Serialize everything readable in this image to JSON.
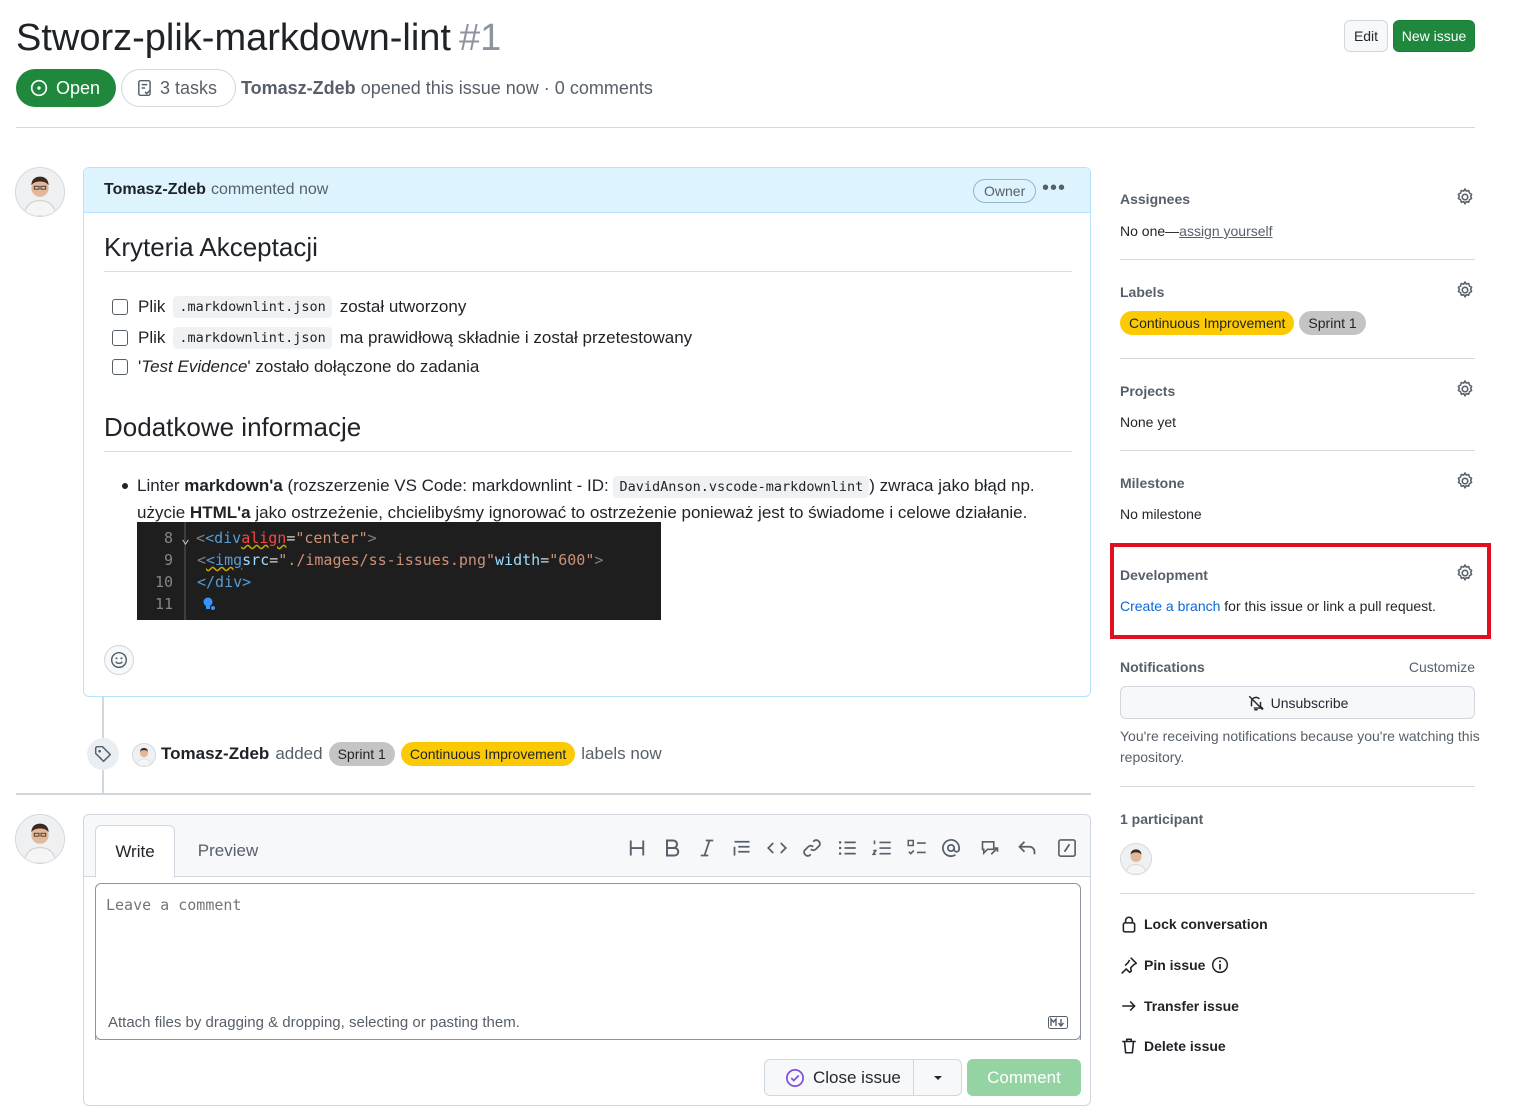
{
  "issue": {
    "title": "Stworz-plik-markdown-lint",
    "number": "#1",
    "state": "Open",
    "tasks": "3 tasks",
    "author": "Tomasz-Zdeb",
    "meta": "opened this issue now · 0 comments"
  },
  "header_buttons": {
    "edit": "Edit",
    "new_issue": "New issue"
  },
  "comment": {
    "author": "Tomasz-Zdeb",
    "time": "commented now",
    "role": "Owner",
    "heading1": "Kryteria Akceptacji",
    "tasks": [
      {
        "pre": "Plik",
        "code": ".markdownlint.json",
        "post": "został utworzony"
      },
      {
        "pre": "Plik",
        "code": ".markdownlint.json",
        "post": "ma prawidłową składnie i został przetestowany"
      },
      {
        "pre": "'",
        "em": "Test Evidence",
        "post": "' zostało dołączone do zadania"
      }
    ],
    "heading2": "Dodatkowe informacje",
    "bullet": {
      "t1": "Linter ",
      "b1": "markdown'a",
      "t2": " (rozszerzenie VS Code: markdownlint - ID: ",
      "code": "DavidAnson.vscode-markdownlint",
      "t3": ") zwraca jako błąd np. użycie ",
      "b2": "HTML'a",
      "t4": " jako ostrzeżenie, chcielibyśmy ignorować to ostrzeżenie ponieważ jest to świadome i celowe działanie."
    },
    "code_image": {
      "lines": [
        {
          "n": "8",
          "parts": [
            "<div ",
            "align",
            "=",
            "\"center\"",
            ">"
          ]
        },
        {
          "n": "9",
          "parts": [
            "<img ",
            "src",
            "=",
            "\"./images/ss-issues.png\"",
            " ",
            "width",
            "=",
            "\"600\"",
            " >"
          ]
        },
        {
          "n": "10",
          "parts": [
            "</div>"
          ]
        },
        {
          "n": "11",
          "parts": []
        }
      ]
    }
  },
  "timeline": {
    "author": "Tomasz-Zdeb",
    "action": "added",
    "labels": [
      "Sprint 1",
      "Continuous Improvement"
    ],
    "suffix": "labels now"
  },
  "editor": {
    "tab_write": "Write",
    "tab_preview": "Preview",
    "placeholder": "Leave a comment",
    "attach": "Attach files by dragging & dropping, selecting or pasting them.",
    "close_issue": "Close issue",
    "submit": "Comment",
    "toolbar": [
      "heading-icon",
      "bold-icon",
      "italic-icon",
      "quote-icon",
      "code-icon",
      "link-icon",
      "bullet-list-icon",
      "numbered-list-icon",
      "task-list-icon",
      "mention-icon",
      "reference-icon",
      "reply-icon",
      "slash-command-icon"
    ]
  },
  "sidebar": {
    "assignees": {
      "title": "Assignees",
      "value": "No one—",
      "link": "assign yourself"
    },
    "labels": {
      "title": "Labels",
      "items": [
        "Continuous Improvement",
        "Sprint 1"
      ]
    },
    "projects": {
      "title": "Projects",
      "value": "None yet"
    },
    "milestone": {
      "title": "Milestone",
      "value": "No milestone"
    },
    "development": {
      "title": "Development",
      "link": "Create a branch",
      "rest": " for this issue or link a pull request."
    },
    "notifications": {
      "title": "Notifications",
      "customize": "Customize",
      "button": "Unsubscribe",
      "note": "You're receiving notifications because you're watching this repository."
    },
    "participants": {
      "title": "1 participant"
    },
    "actions": {
      "lock": "Lock conversation",
      "pin": "Pin issue",
      "transfer": "Transfer issue",
      "delete": "Delete issue"
    }
  },
  "colors": {
    "open_green": "#1f883d",
    "label_ci": "#fbca04",
    "label_sprint": "#c4c4c4",
    "highlight_red": "#e0111f",
    "link_blue": "#0969da"
  }
}
